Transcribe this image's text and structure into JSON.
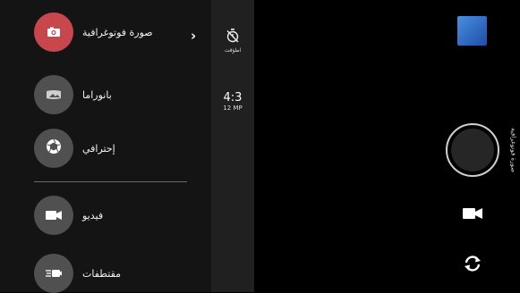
{
  "modes": [
    {
      "label": "صورة فوتوغرافية",
      "icon": "camera-icon",
      "active": true
    },
    {
      "label": "بانوراما",
      "icon": "panorama-icon",
      "active": false
    },
    {
      "label": "إحترافي",
      "icon": "aperture-icon",
      "active": false
    },
    {
      "label": "فيديو",
      "icon": "video-icon",
      "active": false
    },
    {
      "label": "مقتطفات",
      "icon": "hyperlapse-icon",
      "active": false
    }
  ],
  "settings": {
    "timer_label": "اطؤقت",
    "aspect_ratio": "4:3",
    "resolution": "12 MP"
  },
  "right": {
    "current_mode_vertical": "صورة فوتوغرافية"
  },
  "colors": {
    "active_mode": "#c8474c",
    "inactive_mode": "#505050",
    "thumbnail": "#2f6fd0"
  }
}
